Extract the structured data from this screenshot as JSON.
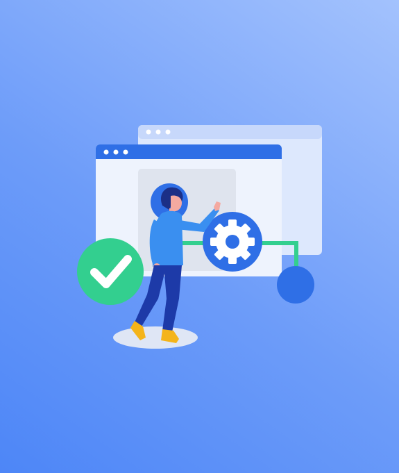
{
  "illustration": {
    "subject": "person-with-browser-windows-and-gear",
    "icons": [
      "browser-window-icon",
      "gear-icon",
      "checkmark-icon",
      "node-circle-icon",
      "person-figure"
    ]
  },
  "colors": {
    "background_start": "#4d86f7",
    "background_end": "#a3c2fd",
    "window_back_body": "#dde8fd",
    "window_back_bar": "#c7d8fb",
    "window_front_body": "#eef3fd",
    "window_front_bar": "#2f6fe6",
    "panel": "#dfe4ee",
    "connector": "#33cf8f",
    "gear": "#2f6fe6",
    "check_badge": "#33cf8f",
    "node_circle": "#2f6fe6",
    "person_shirt": "#3a8ff0",
    "person_pants": "#1d3aa8",
    "person_hair": "#1b2f86",
    "person_skin": "#f4a9a0",
    "person_shoes": "#f4b41a",
    "ground_shadow": "#dfe6f5"
  }
}
